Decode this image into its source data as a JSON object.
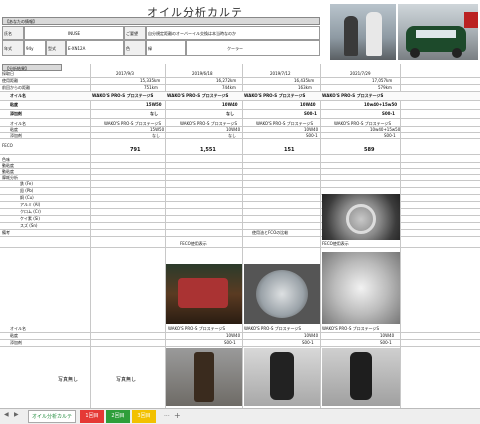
{
  "sheet": {
    "title": "オイル分析カルテ",
    "customer_info_label": "【あなたの情報】",
    "name_label": "氏名",
    "name_value": "INUSE",
    "concern_label": "ご要望",
    "concern_value": "自分規定距離のオーバーイル交換は本当時なのか",
    "model_label": "年式",
    "model_value": "94y",
    "year_label": "年式",
    "engine_label": "型式",
    "engine_value": "E-XN12A",
    "color_label": "色",
    "color_value": "緑",
    "cooler_label": "クーラー",
    "analysis_label": "【分析結果】"
  },
  "dates": [
    "2017/9/3",
    "2019/6/18",
    "2019/7/12",
    "2021/7/29"
  ],
  "distance": [
    "15,335km",
    "16,272km",
    "16,435km",
    "17,057km"
  ],
  "interval": [
    "751km",
    "744km",
    "163km",
    "579km"
  ],
  "oil_name": [
    "WAKO'S PRO-S プロステージS",
    "WAKO'S PRO-S プロステージS",
    "WAKO'S PRO-S プロステージS",
    "WAKO'S PRO-S プロステージS"
  ],
  "viscosity": [
    "15W50",
    "10W40",
    "10W40",
    "10w40+15w50"
  ],
  "additive": [
    "なし",
    "なし",
    "S00-1",
    "S00-1"
  ],
  "rows": {
    "usage": "使用距離",
    "from_change": "前回からの距離",
    "oil_name": "オイル名",
    "viscosity": "粘度",
    "additive": "添加剤",
    "analysis": "分析",
    "ferrography": "FECO",
    "color": "色味",
    "visc40": "動粘度",
    "visc100": "動粘度",
    "metals_label": "摩耗分析",
    "iron": "鉄 (Fe)",
    "lead": "鉛 (Pb)",
    "copper": "銅 (Cu)",
    "alu": "アルミ (Al)",
    "chrome": "クロム (Cr)",
    "silicon": "ケイ素 (Si)",
    "tin": "スズ (Sn)",
    "remarks": "備考"
  },
  "feco_values": [
    "791",
    "1,551",
    "151",
    "589"
  ],
  "notes": {
    "filter": "FECO使用表示",
    "caption1": "使用油とFCOの比較",
    "caption2": "オイル交換時のコンポ",
    "caption3": "FECO使用表示",
    "remarks": "オイル交換時のフィルタ",
    "photo_a": "写真無し",
    "photo_b": "写真無し"
  },
  "tabs": [
    {
      "label": "オイル分析カルテ",
      "color": "#ffffff",
      "text": "#1e8a3a"
    },
    {
      "label": "1回目",
      "color": "#e53935",
      "text": "#ffffff"
    },
    {
      "label": "2回目",
      "color": "#2e9e3a",
      "text": "#ffffff"
    },
    {
      "label": "3回目",
      "color": "#f2c100",
      "text": "#ffffff"
    }
  ],
  "nav": {
    "more": "...",
    "add": "+"
  }
}
